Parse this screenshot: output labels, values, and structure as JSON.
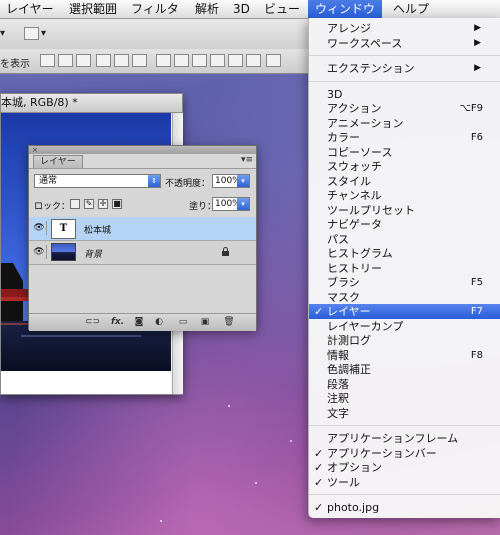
{
  "menubar": {
    "items": [
      {
        "label": "レイヤー"
      },
      {
        "label": "選択範囲"
      },
      {
        "label": "フィルタ"
      },
      {
        "label": "解析"
      },
      {
        "label": "3D"
      },
      {
        "label": "ビュー"
      },
      {
        "label": "ウィンドウ"
      },
      {
        "label": "ヘルプ"
      }
    ]
  },
  "options_bar": {
    "show_transform_label": "を表示"
  },
  "document": {
    "title": "本城, RGB/8) *"
  },
  "layers_panel": {
    "tab_label": "レイヤー",
    "blend_mode": "通常",
    "opacity_label": "不透明度：",
    "opacity_value": "100%",
    "lock_label": "ロック：",
    "fill_label": "塗り：",
    "fill_value": "100%",
    "layers": [
      {
        "name": "松本城",
        "thumb": "T",
        "selected": true
      },
      {
        "name": "背景",
        "selected": false,
        "locked": true
      }
    ]
  },
  "window_menu": {
    "groups": [
      [
        {
          "label": "アレンジ",
          "submenu": true
        },
        {
          "label": "ワークスペース",
          "submenu": true
        }
      ],
      [
        {
          "label": "エクステンション",
          "submenu": true
        }
      ],
      [
        {
          "label": "3D"
        },
        {
          "label": "アクション",
          "shortcut": "⌥F9"
        },
        {
          "label": "アニメーション"
        },
        {
          "label": "カラー",
          "shortcut": "F6"
        },
        {
          "label": "コピーソース"
        },
        {
          "label": "スウォッチ"
        },
        {
          "label": "スタイル"
        },
        {
          "label": "チャンネル"
        },
        {
          "label": "ツールプリセット"
        },
        {
          "label": "ナビゲータ"
        },
        {
          "label": "パス"
        },
        {
          "label": "ヒストグラム"
        },
        {
          "label": "ヒストリー"
        },
        {
          "label": "ブラシ",
          "shortcut": "F5"
        },
        {
          "label": "マスク"
        },
        {
          "label": "レイヤー",
          "shortcut": "F7",
          "checked": true,
          "highlighted": true
        },
        {
          "label": "レイヤーカンプ"
        },
        {
          "label": "計測ログ"
        },
        {
          "label": "情報",
          "shortcut": "F8"
        },
        {
          "label": "色調補正"
        },
        {
          "label": "段落"
        },
        {
          "label": "注釈"
        },
        {
          "label": "文字"
        }
      ],
      [
        {
          "label": "アプリケーションフレーム"
        },
        {
          "label": "アプリケーションバー",
          "checked": true
        },
        {
          "label": "オプション",
          "checked": true
        },
        {
          "label": "ツール",
          "checked": true
        }
      ],
      [
        {
          "label": "photo.jpg",
          "checked": true
        }
      ]
    ],
    "check_glyph": "✓",
    "submenu_glyph": "▶"
  }
}
